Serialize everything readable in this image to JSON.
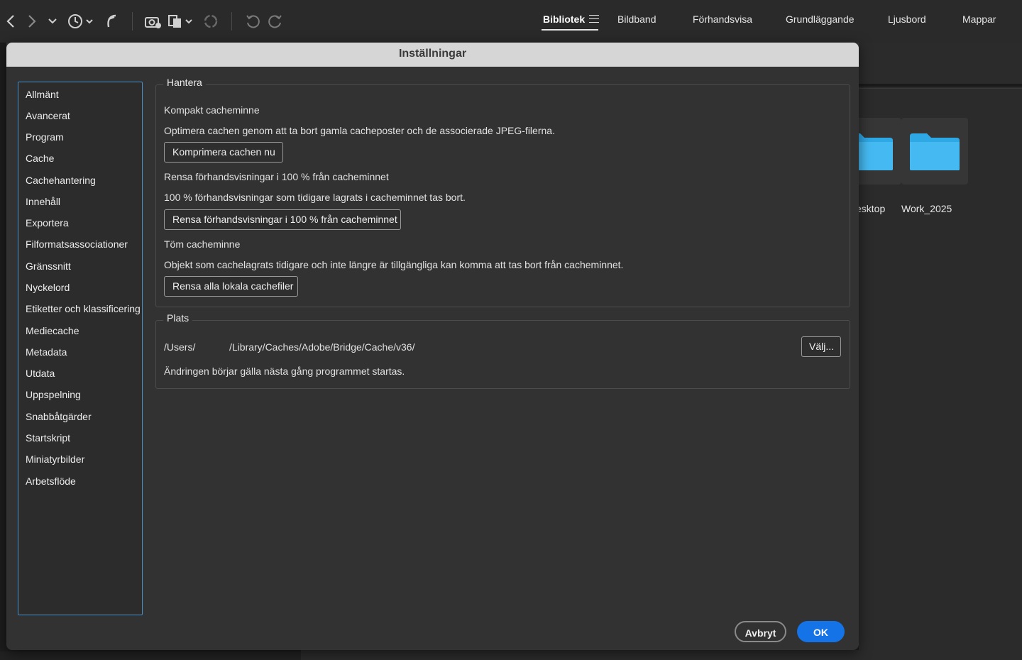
{
  "toolbar": {
    "icons": [
      "back-arrow-icon",
      "forward-arrow-icon",
      "chevron-down-icon",
      "recent-history-icon",
      "boomerang-icon",
      "camera-import-icon",
      "copy-files-icon",
      "refresh-icon",
      "rotate-left-icon",
      "rotate-right-icon"
    ],
    "workspaces": [
      {
        "label": "Bibliotek",
        "active": true
      },
      {
        "label": "Bildband"
      },
      {
        "label": "Förhandsvisa"
      },
      {
        "label": "Grundläggande"
      },
      {
        "label": "Ljusbord"
      },
      {
        "label": "Mappar"
      }
    ]
  },
  "background": {
    "folders": [
      {
        "label": "Desktop",
        "visible_label": "esktop"
      },
      {
        "label": "Work_2025"
      }
    ],
    "folder_color": "#2fa8e6"
  },
  "dialog": {
    "title": "Inställningar",
    "sidebar": [
      "Allmänt",
      "Avancerat",
      "Program",
      "Cache",
      "Cachehantering",
      "Innehåll",
      "Exportera",
      "Filformatsassociationer",
      "Gränssnitt",
      "Nyckelord",
      "Etiketter och klassificering",
      "Mediecache",
      "Metadata",
      "Utdata",
      "Uppspelning",
      "Snabbåtgärder",
      "Startskript",
      "Miniatyrbilder",
      "Arbetsflöde"
    ],
    "selected_item": "Cachehantering",
    "highlight_color": "#f29423",
    "manage": {
      "legend": "Hantera",
      "compact_heading": "Kompakt cacheminne",
      "compact_desc": "Optimera cachen genom att ta bort gamla cacheposter och de associerade JPEG-filerna.",
      "compact_button": "Komprimera cachen nu",
      "purge100_heading": "Rensa förhandsvisningar i 100 % från cacheminnet",
      "purge100_desc": "100 % förhandsvisningar som tidigare lagrats i cacheminnet tas bort.",
      "purge100_button": "Rensa förhandsvisningar i 100 % från cacheminnet",
      "empty_heading": "Töm cacheminne",
      "empty_desc": "Objekt som cachelagrats tidigare och inte längre är tillgängliga kan komma att tas bort från cacheminnet.",
      "empty_button": "Rensa alla lokala cachefiler"
    },
    "location": {
      "legend": "Plats",
      "path_prefix": "/Users/",
      "path_suffix": "/Library/Caches/Adobe/Bridge/Cache/v36/",
      "choose_button": "Välj...",
      "note": "Ändringen börjar gälla nästa gång programmet startas."
    },
    "cancel_button": "Avbryt",
    "ok_button": "OK"
  }
}
